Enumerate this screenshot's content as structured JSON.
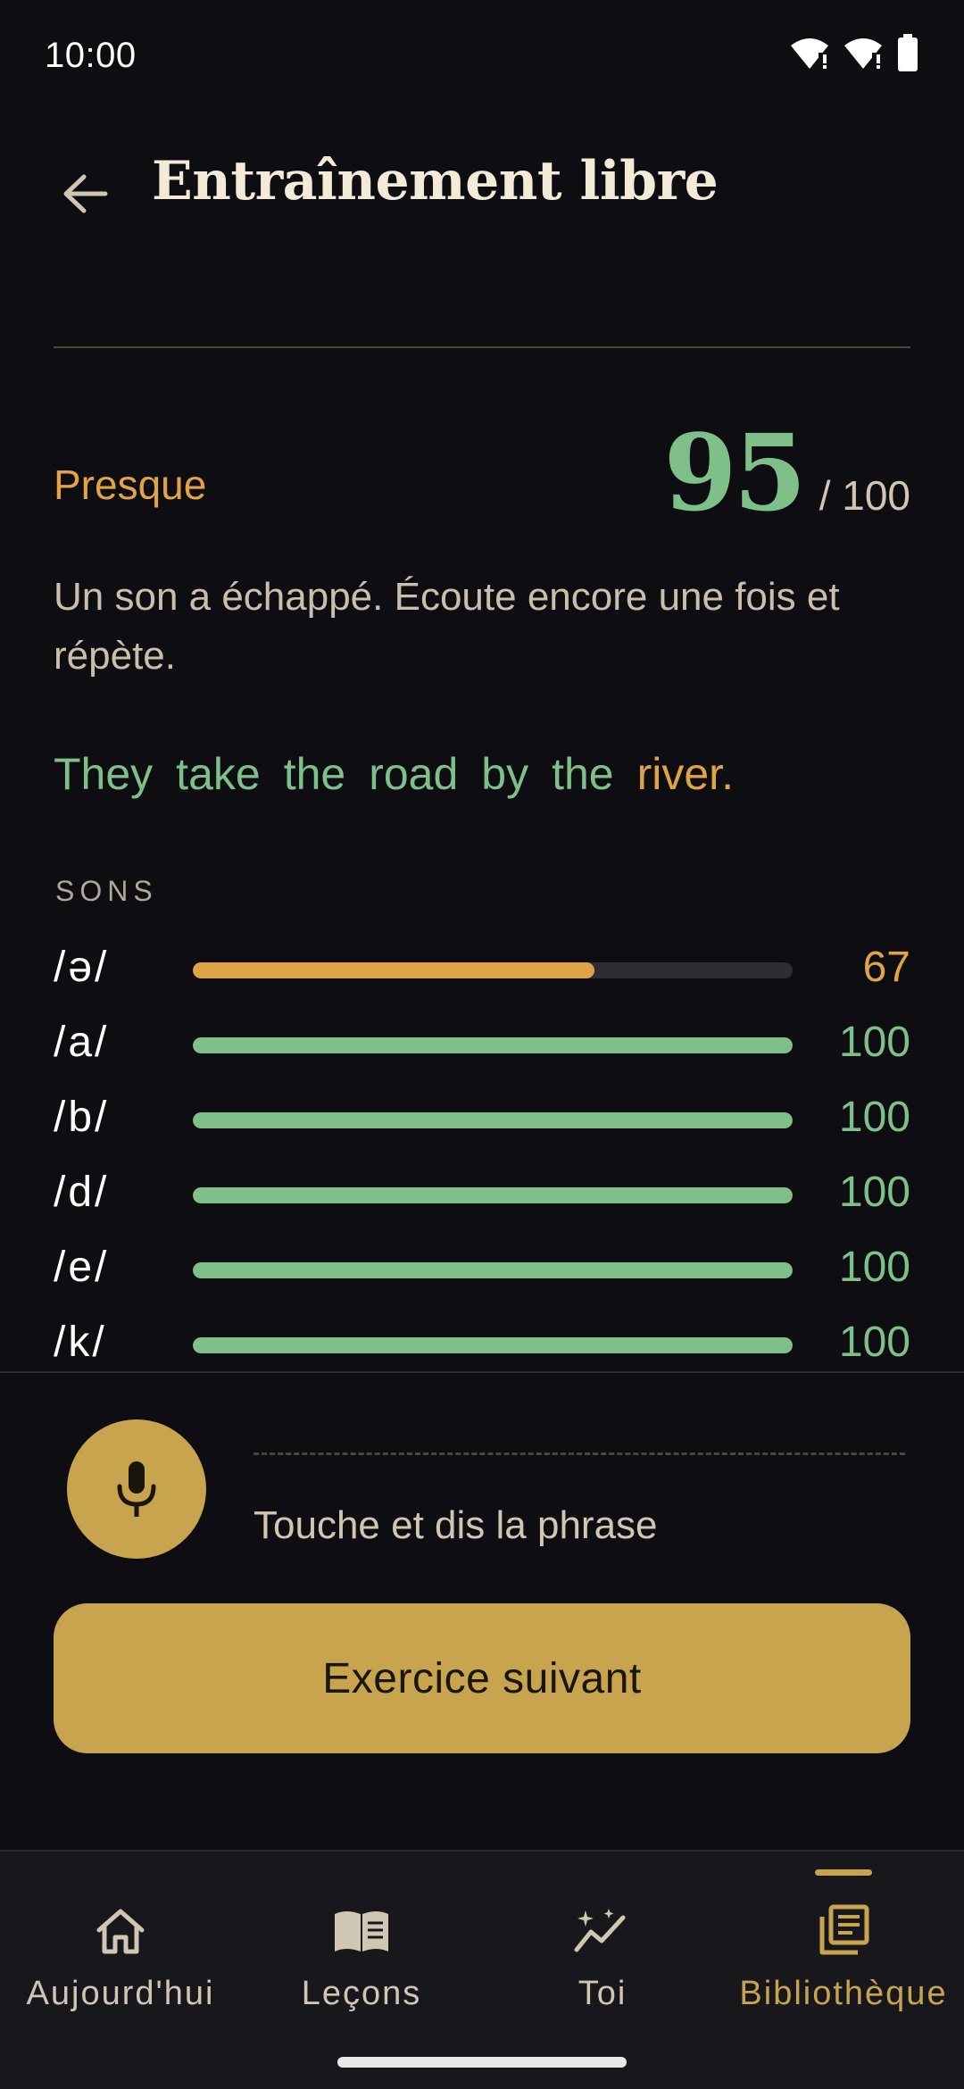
{
  "status": {
    "time": "10:00"
  },
  "header": {
    "title": "Entraînement libre"
  },
  "result": {
    "verdict": "Presque",
    "score": "95",
    "max": "/ 100",
    "feedback": "Un son a échappé. Écoute encore une fois et répète."
  },
  "sentence": [
    {
      "text": "They",
      "state": "good"
    },
    {
      "text": "take",
      "state": "good"
    },
    {
      "text": "the",
      "state": "good"
    },
    {
      "text": "road",
      "state": "good"
    },
    {
      "text": "by",
      "state": "good"
    },
    {
      "text": "the",
      "state": "good"
    },
    {
      "text": "river.",
      "state": "warn"
    }
  ],
  "sounds": {
    "label": "SONS",
    "items": [
      {
        "phoneme": "/ə/",
        "score": 67,
        "level": "warn"
      },
      {
        "phoneme": "/a/",
        "score": 100,
        "level": "good"
      },
      {
        "phoneme": "/b/",
        "score": 100,
        "level": "good"
      },
      {
        "phoneme": "/d/",
        "score": 100,
        "level": "good"
      },
      {
        "phoneme": "/e/",
        "score": 100,
        "level": "good"
      },
      {
        "phoneme": "/k/",
        "score": 100,
        "level": "good"
      }
    ]
  },
  "recorder": {
    "hint": "Touche et dis la phrase",
    "icon": "microphone-icon"
  },
  "actions": {
    "next_label": "Exercice suivant"
  },
  "nav": {
    "items": [
      {
        "label": "Aujourd'hui",
        "icon": "home-icon",
        "active": false
      },
      {
        "label": "Leçons",
        "icon": "book-icon",
        "active": false
      },
      {
        "label": "Toi",
        "icon": "progress-sparkle-icon",
        "active": false
      },
      {
        "label": "Bibliothèque",
        "icon": "library-icon",
        "active": true
      }
    ]
  },
  "colors": {
    "good": "#7fc08a",
    "warn": "#e0a346",
    "accent": "#c8a44e",
    "background": "#0e0e12"
  }
}
